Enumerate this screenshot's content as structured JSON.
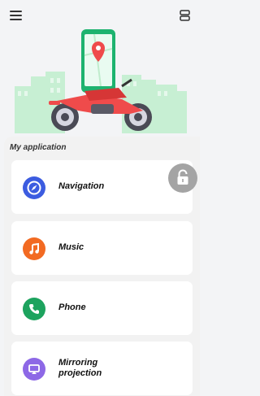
{
  "header": {
    "menu_icon": "menu-icon",
    "device_icon": "device-icon"
  },
  "section_title": "My application",
  "apps": [
    {
      "label": "Navigation",
      "icon": "compass-icon",
      "color": "#3c5ce0"
    },
    {
      "label": "Music",
      "icon": "music-note-icon",
      "color": "#f26a22"
    },
    {
      "label": "Phone",
      "icon": "phone-icon",
      "color": "#1da35e"
    },
    {
      "label": "Mirroring projection",
      "label_lines": [
        "Mirroring",
        "projection"
      ],
      "icon": "cast-icon",
      "color": "#8d68e6"
    }
  ],
  "lock_button": {
    "icon": "lock-icon",
    "color": "#a4a4a4"
  },
  "colors": {
    "background": "#f3f4f6",
    "card": "#ffffff",
    "motorcycle": "#ef4b4b",
    "city": "#bfeccc"
  }
}
